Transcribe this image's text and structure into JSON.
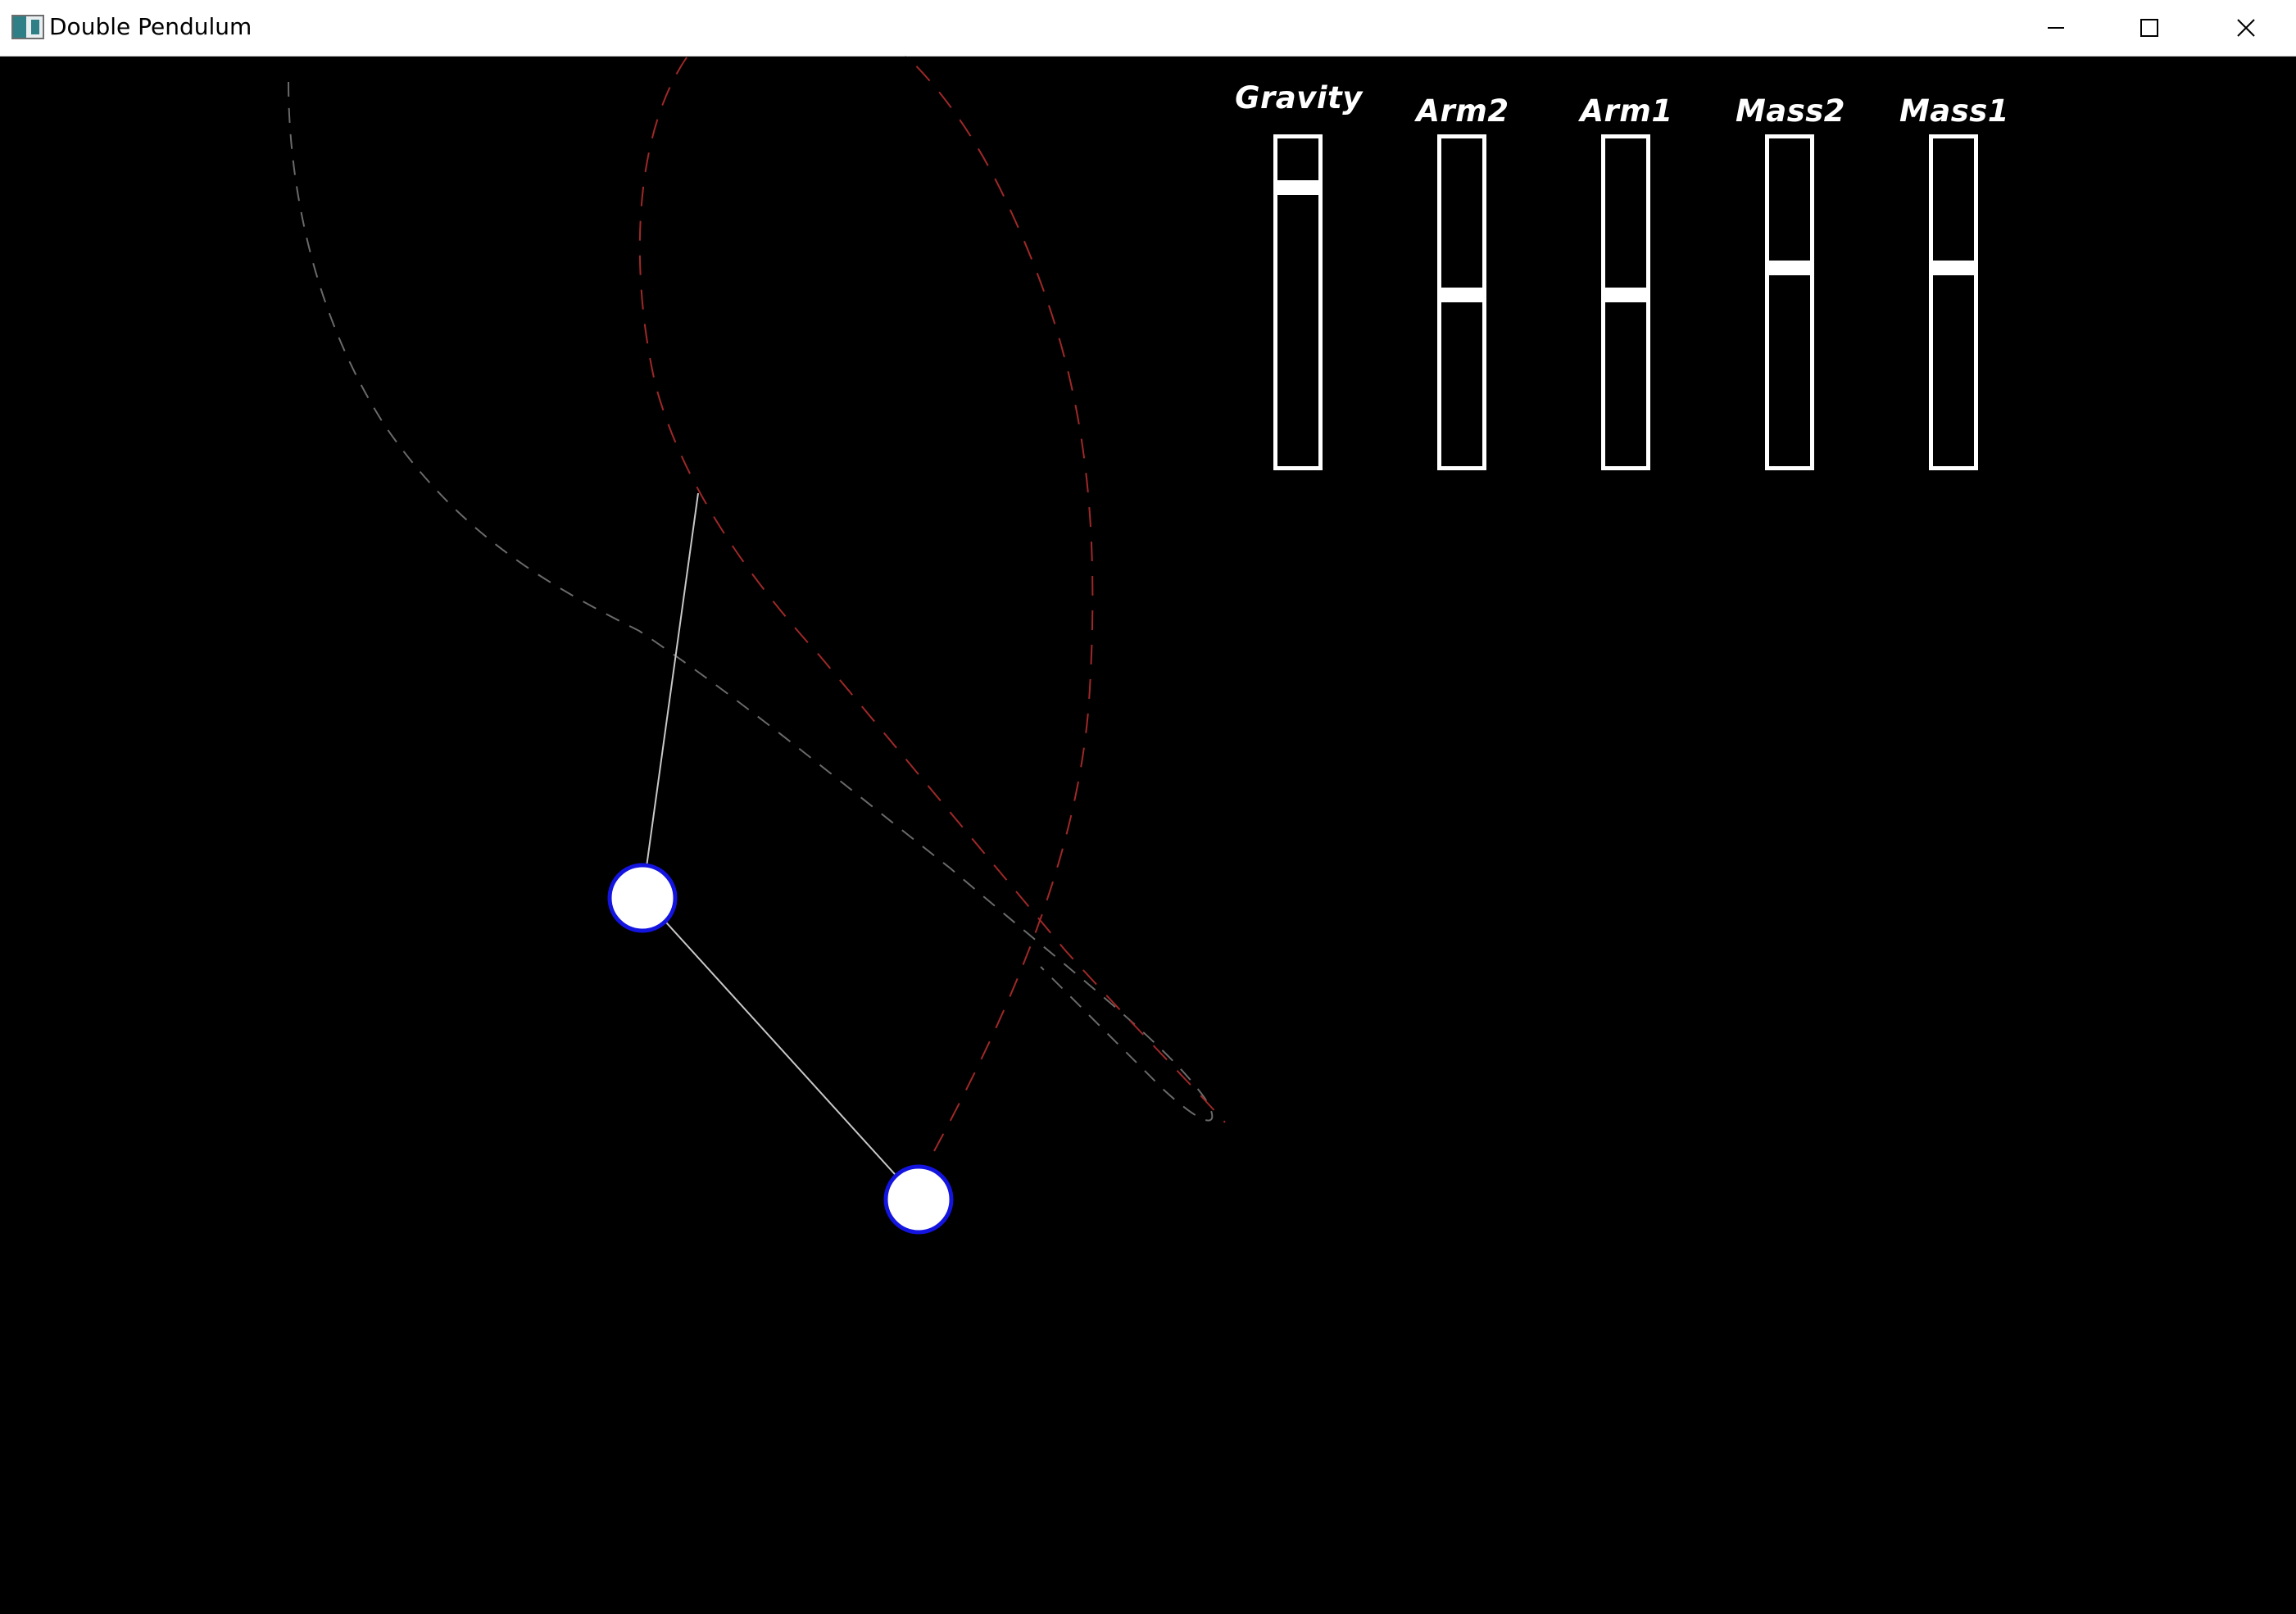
{
  "window": {
    "title": "Double Pendulum",
    "icon": "app-icon"
  },
  "titlebar_buttons": [
    {
      "name": "minimize",
      "icon": "minimize-icon"
    },
    {
      "name": "maximize",
      "icon": "maximize-icon"
    },
    {
      "name": "close",
      "icon": "close-icon"
    }
  ],
  "sliders": [
    {
      "label": "Gravity",
      "level": 0.9
    },
    {
      "label": "Arm2",
      "level": 0.5
    },
    {
      "label": "Arm1",
      "level": 0.5
    },
    {
      "label": "Mass2",
      "level": 0.6
    },
    {
      "label": "Mass1",
      "level": 0.6
    }
  ],
  "colors": {
    "background": "#000000",
    "bob_fill": "#ffffff",
    "bob_outline": "#1414e0",
    "rod": "#c8c8c8",
    "trail_bob1": "#6a6a6a",
    "trail_bob2": "#a02828",
    "slider": "#ffffff"
  }
}
